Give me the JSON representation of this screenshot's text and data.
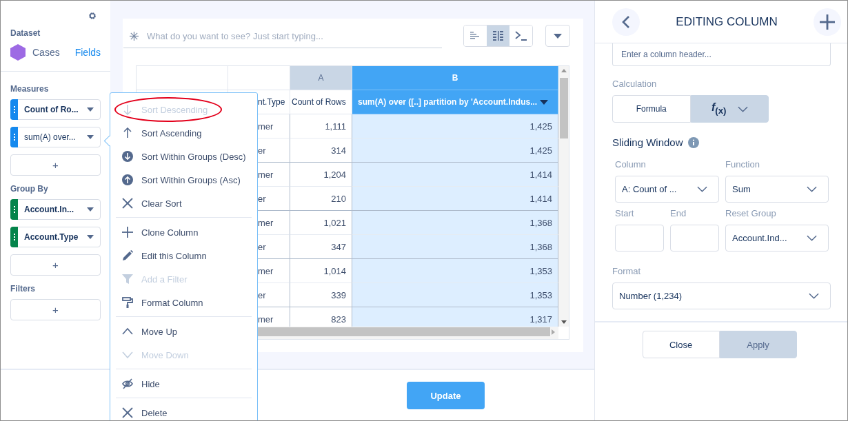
{
  "sidebar": {
    "dataset_label": "Dataset",
    "dataset_name": "Cases",
    "fields_link": "Fields",
    "sections": [
      {
        "title": "Measures",
        "pills": [
          {
            "label": "Count of Ro...",
            "color": "#1589ee",
            "bold": true
          },
          {
            "label": "sum(A) over...",
            "color": "#1589ee",
            "bold": false
          }
        ],
        "add": "+"
      },
      {
        "title": "Group By",
        "pills": [
          {
            "label": "Account.In...",
            "color": "#04844b",
            "bold": true
          },
          {
            "label": "Account.Type",
            "color": "#04844b",
            "bold": true
          }
        ],
        "add": "+"
      },
      {
        "title": "Filters",
        "add": "+"
      }
    ]
  },
  "query": {
    "placeholder": "What do you want to see? Just start typing...",
    "view_buttons": [
      {
        "kind": "bars",
        "selected": false
      },
      {
        "kind": "grid",
        "selected": true
      },
      {
        "kind": "console",
        "selected": false
      }
    ]
  },
  "table": {
    "columns": [
      {
        "name": "nt.Type",
        "selected": false
      },
      {
        "letter": "A",
        "name": "Count of Rows",
        "selected": false
      },
      {
        "letter": "B",
        "name": "sum(A) over ([..] partition by 'Account.Indus...",
        "selected": true
      }
    ],
    "rows": [
      {
        "cells": [
          "mer",
          "1,111",
          "1,425"
        ],
        "group_end": false
      },
      {
        "cells": [
          "er",
          "314",
          "1,425"
        ],
        "group_end": true
      },
      {
        "cells": [
          "mer",
          "1,204",
          "1,414"
        ],
        "group_end": false
      },
      {
        "cells": [
          "er",
          "210",
          "1,414"
        ],
        "group_end": true
      },
      {
        "cells": [
          "mer",
          "1,021",
          "1,368"
        ],
        "group_end": false
      },
      {
        "cells": [
          "er",
          "347",
          "1,368"
        ],
        "group_end": true
      },
      {
        "cells": [
          "mer",
          "1,014",
          "1,353"
        ],
        "group_end": false
      },
      {
        "cells": [
          "er",
          "339",
          "1,353"
        ],
        "group_end": true
      },
      {
        "cells": [
          "mer",
          "823",
          "1,317"
        ],
        "group_end": false
      }
    ]
  },
  "context_menu": {
    "groups": [
      [
        {
          "kind": "sort-desc",
          "label": "Sort Descending",
          "disabled": true,
          "circled": true
        },
        {
          "kind": "sort-asc",
          "label": "Sort Ascending",
          "disabled": false,
          "circled": false
        },
        {
          "kind": "group-desc",
          "label": "Sort Within Groups (Desc)",
          "disabled": false,
          "circled": false
        },
        {
          "kind": "group-asc",
          "label": "Sort Within Groups (Asc)",
          "disabled": false,
          "circled": false
        },
        {
          "kind": "clear",
          "label": "Clear Sort",
          "disabled": false,
          "circled": false
        }
      ],
      [
        {
          "kind": "clone",
          "label": "Clone Column",
          "disabled": false,
          "circled": false
        },
        {
          "kind": "edit",
          "label": "Edit this Column",
          "disabled": false,
          "circled": false
        },
        {
          "kind": "filter",
          "label": "Add a Filter",
          "disabled": true,
          "circled": false
        },
        {
          "kind": "format",
          "label": "Format Column",
          "disabled": false,
          "circled": false
        }
      ],
      [
        {
          "kind": "up",
          "label": "Move Up",
          "disabled": false,
          "circled": false
        },
        {
          "kind": "down",
          "label": "Move Down",
          "disabled": true,
          "circled": false
        }
      ],
      [
        {
          "kind": "hide",
          "label": "Hide",
          "disabled": false,
          "circled": false
        }
      ],
      [
        {
          "kind": "delete",
          "label": "Delete",
          "disabled": false,
          "circled": false
        }
      ]
    ]
  },
  "update_button": "Update",
  "editor": {
    "title": "EDITING COLUMN",
    "header_placeholder": "Enter a column header...",
    "calculation_label": "Calculation",
    "calc_options": [
      {
        "label": "Formula",
        "selected": false,
        "dropdown": false
      },
      {
        "label": "*f*$_{(x)}$",
        "selected": true,
        "dropdown": true
      }
    ],
    "sliding_window": {
      "title": "Sliding Window",
      "rows": [
        [
          {
            "kind": "select",
            "label": "Column",
            "value": "A: Count of ..."
          },
          "",
          {
            "kind": "select",
            "label": "Function",
            "value": "Sum"
          }
        ],
        [
          {
            "kind": "input",
            "label": "Start"
          },
          {
            "kind": "input",
            "label": "End"
          },
          {
            "kind": "select",
            "label": "Reset Group",
            "value": "Account.Ind..."
          }
        ]
      ]
    },
    "format_label": "Format",
    "format_value": "Number (1,234)",
    "buttons": [
      {
        "kind": "neutral",
        "label": "Close"
      },
      {
        "kind": "primary",
        "label": "Apply"
      }
    ]
  }
}
